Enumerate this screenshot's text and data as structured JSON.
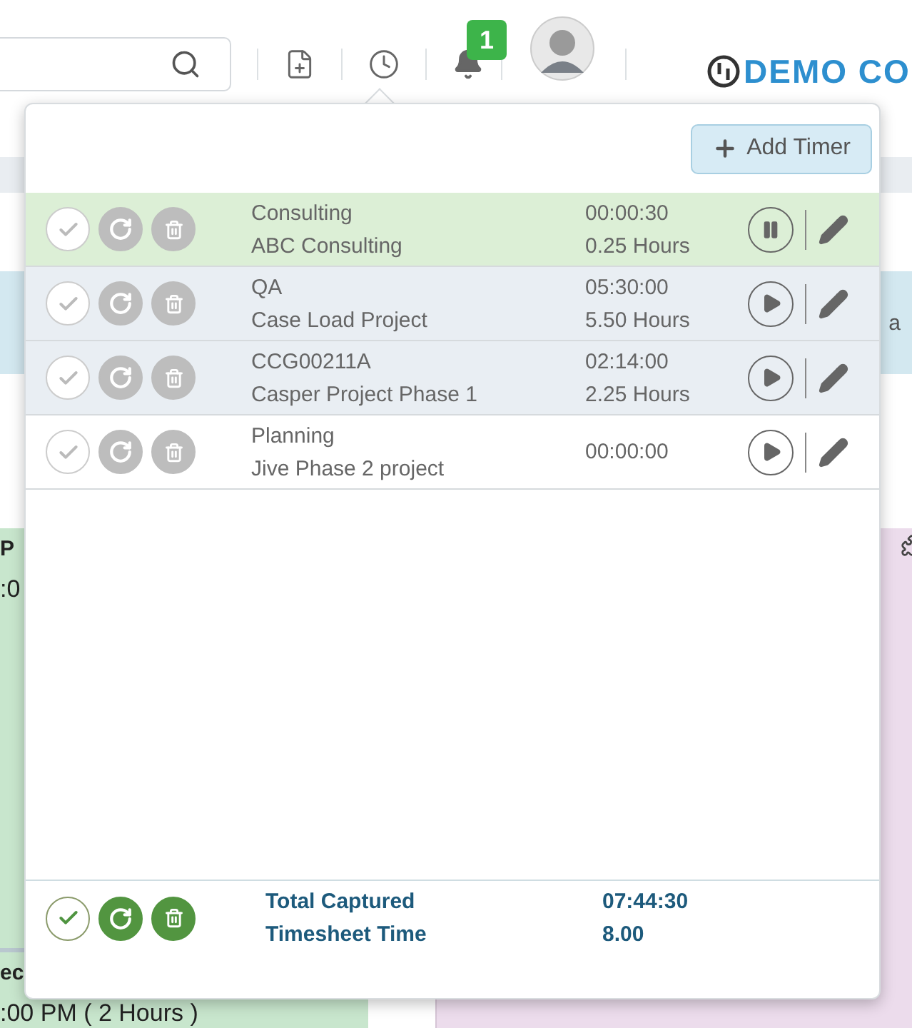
{
  "header": {
    "badge": "1",
    "logo_text": "DEMO CO"
  },
  "background": {
    "band_label": "a",
    "left_top": [
      "P",
      ":0"
    ],
    "left_bottom": [
      "ec",
      ":00 PM ( 2 Hours )"
    ]
  },
  "timer_popover": {
    "add_button": "Add Timer",
    "timers": [
      {
        "task": "Consulting",
        "project": "ABC Consulting",
        "elapsed": "00:00:30",
        "hours": "0.25 Hours",
        "kind": "running",
        "disabled": true
      },
      {
        "task": "QA",
        "project": "Case Load Project",
        "elapsed": "05:30:00",
        "hours": "5.50 Hours",
        "kind": "paused",
        "disabled": true
      },
      {
        "task": "CCG00211A",
        "project": "Casper Project Phase 1",
        "elapsed": "02:14:00",
        "hours": "2.25 Hours",
        "kind": "paused",
        "disabled": true
      },
      {
        "task": "Planning",
        "project": "Jive Phase 2 project",
        "elapsed": "00:00:00",
        "kind": "new",
        "disabled": true
      }
    ],
    "footer": {
      "disabled": false,
      "total_label": "Total Captured",
      "total_value": "07:44:30",
      "timesheet_label": "Timesheet Time",
      "timesheet_value": "8.00"
    }
  }
}
